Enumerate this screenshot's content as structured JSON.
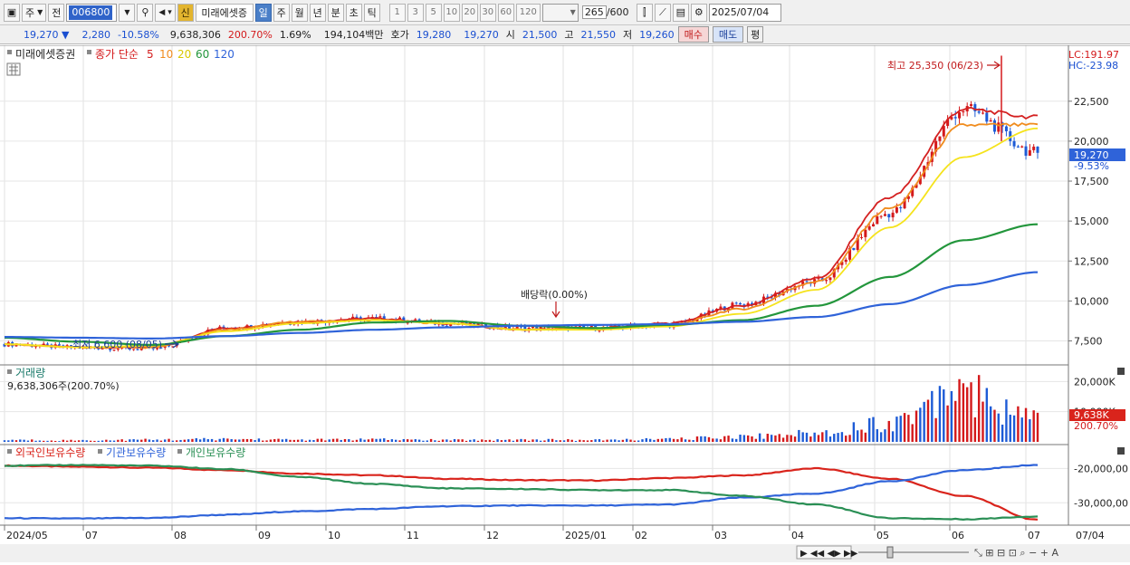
{
  "toolbar": {
    "period_jo": "주",
    "jeon": "전",
    "code": "006800",
    "new_badge": "신",
    "stock_name": "미래에셋증",
    "tabs": [
      "일",
      "주",
      "월",
      "년",
      "분",
      "초",
      "틱"
    ],
    "active_tab": "일",
    "minute_options": [
      "1",
      "3",
      "5",
      "10",
      "20",
      "30",
      "60",
      "120"
    ],
    "count": "265",
    "count_total": "/600",
    "date": "2025/07/04"
  },
  "quote": {
    "price": "19,270 ▼",
    "change": "2,280",
    "change_pct": "-10.58%",
    "volume": "9,638,306",
    "volume_ratio": "200.70%",
    "turnover": "1.69%",
    "amount": "194,104백만",
    "hoga_label": "호가",
    "ask": "19,280",
    "bid": "19,270",
    "open_label": "시",
    "open": "21,500",
    "high_label": "고",
    "high": "21,550",
    "low_label": "저",
    "low": "19,260",
    "buy_button": "매수",
    "sell_button": "매도",
    "avg_button": "평"
  },
  "price_panel": {
    "stock_name": "미래에셋증권",
    "ma_title": "종가 단순",
    "ma_periods": [
      "5",
      "10",
      "20",
      "60",
      "120"
    ],
    "lc": "LC:191.97",
    "hc": "HC:-23.98",
    "current_price_tag": "19,270",
    "current_pct_tag": "-9.53%",
    "y_ticks": [
      "22,500",
      "20,000",
      "17,500",
      "15,000",
      "12,500",
      "10,000",
      "7,500"
    ],
    "max_annotation": "최고 25,350 (06/23)",
    "min_annotation": "최저 6,600 (08/05)",
    "dividend_annotation": "배당락(0.00%)"
  },
  "volume_panel": {
    "title": "거래량",
    "info": "9,638,306주(200.70%)",
    "y_ticks": [
      "20,000K",
      "10,000K"
    ],
    "current_tag": "9,638K",
    "ratio_tag": "200.70%"
  },
  "holdings_panel": {
    "legend": [
      "외국인보유수량",
      "기관보유수량",
      "개인보유수량"
    ],
    "y_ticks": [
      "-20,000,00",
      "-30,000,00"
    ]
  },
  "x_axis": {
    "labels": [
      "2024/05",
      "07",
      "08",
      "09",
      "10",
      "11",
      "12",
      "2025/01",
      "02",
      "03",
      "04",
      "05",
      "06",
      "07"
    ],
    "right_label": "07/04"
  },
  "colors": {
    "up": "#d4191b",
    "down": "#1d5bd6",
    "ma5": "#d42020",
    "ma10": "#f08c1e",
    "ma20": "#f5e31c",
    "ma60": "#23963c",
    "ma120": "#2f63d9",
    "foreign": "#d9241c",
    "institution": "#2f63d9",
    "individual": "#2a8f55"
  },
  "chart_data": [
    {
      "type": "candlestick",
      "title": "미래에셋증권",
      "x": [
        "2024/05",
        "07",
        "08",
        "09",
        "10",
        "11",
        "12",
        "2025/01",
        "02",
        "03",
        "04",
        "05",
        "06",
        "07"
      ],
      "series": [
        {
          "name": "종가",
          "values": [
            7300,
            7100,
            7000,
            8300,
            8700,
            8900,
            8600,
            8300,
            8300,
            8500,
            9800,
            11200,
            15500,
            22000,
            19270
          ]
        },
        {
          "name": "5",
          "values": [
            7300,
            7100,
            7100,
            8300,
            8700,
            8900,
            8600,
            8200,
            8300,
            8600,
            9700,
            11400,
            16500,
            22000,
            21500
          ]
        },
        {
          "name": "10",
          "values": [
            7300,
            7100,
            7100,
            8200,
            8700,
            8800,
            8600,
            8200,
            8300,
            8500,
            9500,
            11200,
            15800,
            21000,
            21000
          ]
        },
        {
          "name": "20",
          "values": [
            7300,
            7100,
            7200,
            8100,
            8600,
            8800,
            8600,
            8200,
            8200,
            8400,
            9200,
            10700,
            14600,
            19000,
            20800
          ]
        },
        {
          "name": "60",
          "values": [
            7700,
            7450,
            7250,
            7800,
            8200,
            8650,
            8750,
            8450,
            8300,
            8500,
            8800,
            9700,
            11500,
            13800,
            14800
          ]
        },
        {
          "name": "120",
          "values": [
            7750,
            7700,
            7650,
            7800,
            8000,
            8200,
            8350,
            8450,
            8500,
            8550,
            8700,
            9000,
            9800,
            11000,
            11800
          ]
        }
      ],
      "max": {
        "label": "최고",
        "value": 25350,
        "date": "06/23"
      },
      "min": {
        "label": "최저",
        "value": 6600,
        "date": "08/05"
      },
      "current": 19270,
      "ylim": [
        6000,
        26000
      ]
    },
    {
      "type": "bar",
      "title": "거래량",
      "series": [
        {
          "name": "거래량",
          "values": [
            600,
            500,
            700,
            900,
            700,
            800,
            600,
            700,
            600,
            900,
            1800,
            2800,
            6500,
            20000,
            9638
          ]
        }
      ],
      "ylim": [
        0,
        24000
      ],
      "unit": "K"
    },
    {
      "type": "line",
      "series": [
        {
          "name": "외국인보유수량",
          "values": [
            -19.2,
            -19.5,
            -19.8,
            -20.5,
            -21.5,
            -22.0,
            -23.0,
            -23.4,
            -23.5,
            -22.8,
            -22.0,
            -20.0,
            -23.0,
            -28.0,
            -35.0
          ]
        },
        {
          "name": "기관보유수량",
          "values": [
            -34.5,
            -34.6,
            -34.4,
            -33.5,
            -32.5,
            -31.8,
            -31.0,
            -30.8,
            -30.8,
            -30.5,
            -28.5,
            -27.3,
            -23.7,
            -20.5,
            -19.0
          ]
        },
        {
          "name": "개인보유수량",
          "values": [
            -19.2,
            -19.0,
            -19.2,
            -20.2,
            -22.5,
            -24.5,
            -25.8,
            -26.0,
            -26.3,
            -26.3,
            -28.0,
            -30.5,
            -34.5,
            -34.8,
            -34.0
          ]
        }
      ],
      "ylim": [
        -36,
        -17
      ],
      "unit": "백만주"
    }
  ]
}
